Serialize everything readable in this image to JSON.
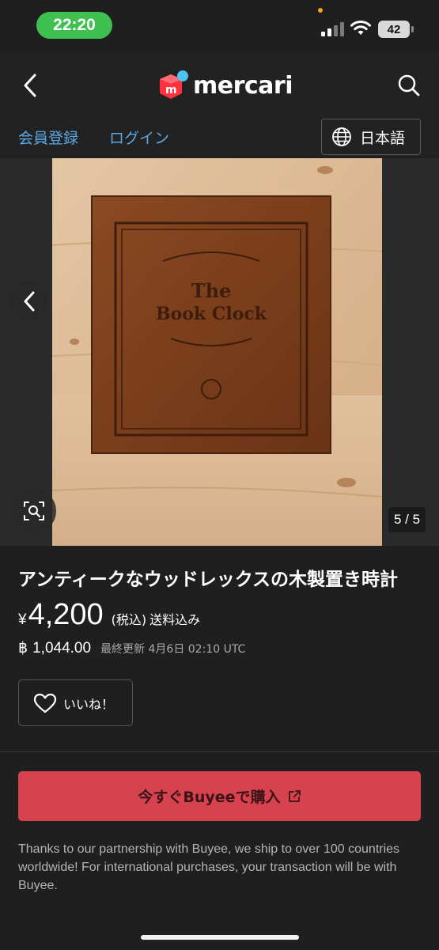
{
  "status_bar": {
    "time": "22:20",
    "battery": "42"
  },
  "header": {
    "logo_text": "mercari"
  },
  "auth": {
    "register": "会員登録",
    "login": "ログイン",
    "language": "日本語"
  },
  "gallery": {
    "counter": "5 / 5",
    "photo_text_line1": "The",
    "photo_text_line2": "Book Clock"
  },
  "item": {
    "title": "アンティークなウッドレックスの木製置き時計",
    "currency_symbol": "¥",
    "price": "4,200",
    "tax_note": "(税込)",
    "shipping": "送料込み",
    "alt_currency_symbol": "฿",
    "alt_price": "1,044.00",
    "updated": "最終更新 4月6日 02:10 UTC"
  },
  "actions": {
    "like": "いいね！",
    "buy": "今すぐBuyeeで購入"
  },
  "notice": "Thanks to our partnership with Buyee, we ship to over 100 countries worldwide! For international purchases, your transaction will be with Buyee.",
  "colors": {
    "brand_red": "#ff333f",
    "link_blue": "#5aa9e6",
    "buy_button": "#d6424e",
    "time_pill": "#3fc152"
  },
  "icons": [
    "back-chevron-icon",
    "search-icon",
    "globe-icon",
    "prev-arrow-icon",
    "image-search-icon",
    "heart-icon",
    "external-link-icon"
  ]
}
